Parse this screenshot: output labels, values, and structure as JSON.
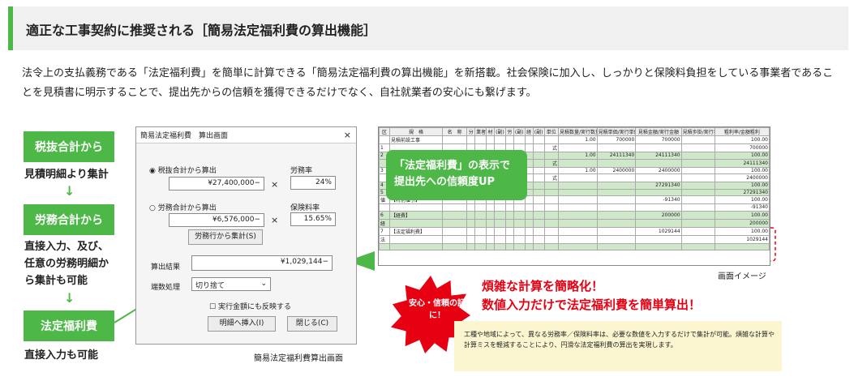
{
  "header": {
    "title": "適正な工事契約に推奨される［簡易法定福利費の算出機能］"
  },
  "intro": "法令上の支払義務である「法定福利費」を簡単に計算できる「簡易法定福利費の算出機能」を新搭載。社会保険に加入し、しっかりと保険料負担をしている事業者であることを見積書に明示することで、提出先からの信頼を獲得できるだけでなく、自社就業者の安心にも繋げます。",
  "steps": [
    {
      "box": "税抜合計から",
      "desc": "見積明細より集計"
    },
    {
      "box": "労務合計から",
      "desc": "直接入力、及び、任意の労務明細から集計も可能"
    },
    {
      "box": "法定福利費",
      "desc": "直接入力も可能"
    }
  ],
  "dialog": {
    "title": "簡易法定福利費　算出画面",
    "close": "×",
    "opt1": "税抜合計から算出",
    "opt1_value": "¥27,400,000−",
    "labor_rate_label": "労務率",
    "labor_rate": "24%",
    "times": "×",
    "opt2": "労務合計から算出",
    "opt2_value": "¥6,576,000−",
    "ins_rate_label": "保険料率",
    "ins_rate": "15.65%",
    "collect_btn": "労務行から集計(S)",
    "result_label": "算出結果",
    "result": "¥1,029,144−",
    "rounding_label": "端数処理",
    "rounding": "切り捨て",
    "reflect": "実行金額にも反映する",
    "insert_btn": "明細へ挿入(I)",
    "close_btn": "閉じる(C)",
    "caption": "簡易法定福利費算出画面"
  },
  "sheet": {
    "headers": [
      "区",
      "規　格",
      "名　称",
      "分",
      "業者",
      "材",
      "(副)",
      "労",
      "(副)",
      "経",
      "(副)",
      "単位",
      "見積数量/実行数量",
      "見積単価/実行単価",
      "見積金額/実行金額",
      "見積歩掛/実行歩掛",
      "粗利率/金額粗利"
    ],
    "rows": [
      {
        "g": false,
        "c": [
          "",
          "見積前設工事",
          "",
          "",
          "",
          "",
          "",
          "",
          "",
          "",
          "",
          "",
          "1.00",
          "700000",
          "700000",
          "",
          "100.00"
        ]
      },
      {
        "g": false,
        "c": [
          "1",
          "",
          "",
          "",
          "",
          "",
          "",
          "",
          "",
          "",
          "",
          "式",
          "",
          "",
          "",
          "",
          "700000"
        ]
      },
      {
        "g": true,
        "c": [
          "2",
          "",
          "",
          "",
          "",
          "",
          "",
          "",
          "",
          "",
          "",
          "",
          "1.00",
          "24111340",
          "24111340",
          "",
          "100.00"
        ]
      },
      {
        "g": true,
        "c": [
          "",
          "",
          "",
          "",
          "",
          "",
          "",
          "",
          "",
          "",
          "",
          "式",
          "",
          "",
          "",
          "",
          "24111340"
        ]
      },
      {
        "g": false,
        "c": [
          "3",
          "",
          "",
          "",
          "",
          "",
          "",
          "",
          "",
          "",
          "",
          "",
          "1.00",
          "2400000",
          "2400000",
          "",
          "100.00"
        ]
      },
      {
        "g": false,
        "c": [
          "",
          "",
          "",
          "",
          "",
          "",
          "",
          "",
          "",
          "",
          "",
          "式",
          "",
          "",
          "",
          "",
          "2400000"
        ]
      },
      {
        "g": true,
        "c": [
          "4",
          "",
          "",
          "",
          "",
          "",
          "",
          "",
          "",
          "",
          "",
          "",
          "",
          "",
          "27291340",
          "",
          "100.00"
        ]
      },
      {
        "g": true,
        "c": [
          "5",
          "",
          "",
          "",
          "",
          "",
          "",
          "",
          "",
          "",
          "",
          "",
          "",
          "",
          "",
          "",
          "27291340"
        ]
      },
      {
        "g": false,
        "c": [
          "値",
          "【特別値引】",
          "",
          "",
          "",
          "",
          "",
          "",
          "",
          "",
          "",
          "",
          "",
          "",
          "-91340",
          "",
          "100.00"
        ]
      },
      {
        "g": false,
        "c": [
          "",
          "",
          "",
          "",
          "",
          "",
          "",
          "",
          "",
          "",
          "",
          "",
          "",
          "",
          "",
          "",
          "-91340"
        ]
      },
      {
        "g": true,
        "c": [
          "6",
          "【経費】",
          "",
          "",
          "",
          "",
          "",
          "",
          "",
          "",
          "",
          "",
          "",
          "",
          "200000",
          "",
          "100.00"
        ]
      },
      {
        "g": true,
        "c": [
          "経",
          "",
          "",
          "",
          "",
          "",
          "",
          "",
          "",
          "",
          "",
          "",
          "",
          "",
          "",
          "",
          "200000"
        ]
      },
      {
        "g": false,
        "c": [
          "7",
          "【法定福利費】",
          "",
          "",
          "",
          "",
          "",
          "",
          "",
          "",
          "",
          "",
          "",
          "",
          "1029144",
          "",
          "100.00"
        ]
      },
      {
        "g": false,
        "c": [
          "法",
          "",
          "",
          "",
          "",
          "",
          "",
          "",
          "",
          "",
          "",
          "",
          "",
          "",
          "",
          "",
          "1029144"
        ]
      },
      {
        "g": true,
        "c": [
          "",
          "",
          "",
          "",
          "",
          "",
          "",
          "",
          "",
          "",
          "",
          "",
          "",
          "",
          "",
          "",
          ""
        ]
      }
    ],
    "caption": "画面イメージ"
  },
  "bubble": {
    "line1": "「法定福利費」の表示で",
    "line2": "提出先への信頼度UP"
  },
  "badge": "安心・信頼の証に！",
  "headline1": "煩雑な計算を簡略化！",
  "headline2": "数値入力だけで法定福利費を簡単算出！",
  "note": "工種や地域によって、異なる労務率／保険料率は、必要な数値を入力するだけで集計が可能。煩雑な計算や計算ミスを軽減することにより、円滑な法定福利費の算出を実現します。",
  "colors": {
    "accent": "#4db848",
    "red": "#e60012",
    "note_bg": "#fbf6cf"
  }
}
